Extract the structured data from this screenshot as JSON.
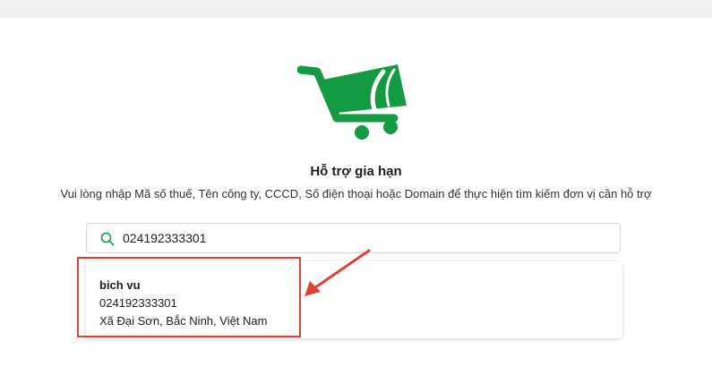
{
  "page": {
    "title": "Hỗ trợ gia hạn",
    "subtitle": "Vui lòng nhập Mã số thuế, Tên công ty, CCCD, Số điện thoại hoặc Domain để thực hiện tìm kiếm đơn vị cần hỗ trợ"
  },
  "search": {
    "value": "024192333301",
    "icon": "search-icon"
  },
  "results": [
    {
      "name": "bich vu",
      "tax_code": "024192333301",
      "address": "Xã Đại Sơn, Bắc Ninh, Việt Nam"
    }
  ],
  "colors": {
    "brand_green": "#139a43",
    "highlight_red": "#d9433b"
  }
}
